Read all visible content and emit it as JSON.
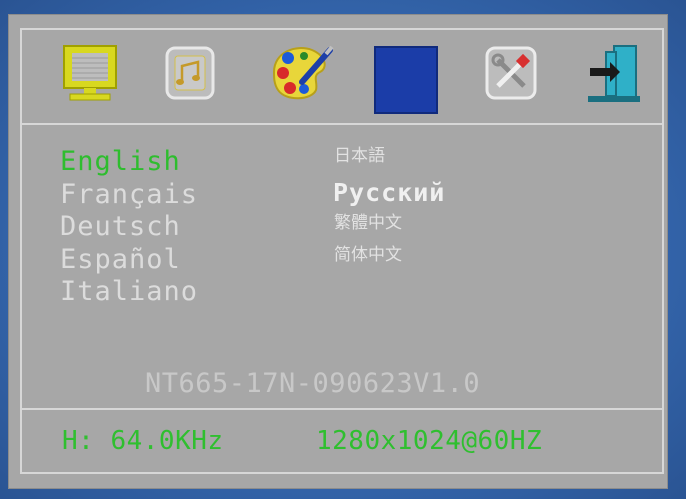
{
  "osd": {
    "tabs": [
      {
        "icon": "monitor-icon",
        "selected": false
      },
      {
        "icon": "audio-icon",
        "selected": false
      },
      {
        "icon": "color-palette-icon",
        "selected": false
      },
      {
        "icon": "language-tab-icon",
        "selected": true
      },
      {
        "icon": "tools-icon",
        "selected": false
      },
      {
        "icon": "exit-icon",
        "selected": false
      }
    ],
    "languages": {
      "english": "English",
      "francais": "Français",
      "deutsch": "Deutsch",
      "espanol": "Español",
      "italiano": "Italiano",
      "japanese": "日本語",
      "russian": "Русский",
      "trad_chinese": "繁體中文",
      "simp_chinese": "简体中文"
    },
    "selected_language": "English",
    "firmware": "NT665-17N-090623V1.0",
    "status": {
      "horizontal_frequency": "H: 64.0KHz",
      "resolution_refresh": "1280x1024@60HZ"
    }
  },
  "colors": {
    "osd_background": "#a7a7a7",
    "active_text": "#2ebd2e",
    "inactive_text": "#dcdcdc",
    "selected_tab": "#1b3da8",
    "screen_bezel_blue": "#3a6fb4"
  }
}
